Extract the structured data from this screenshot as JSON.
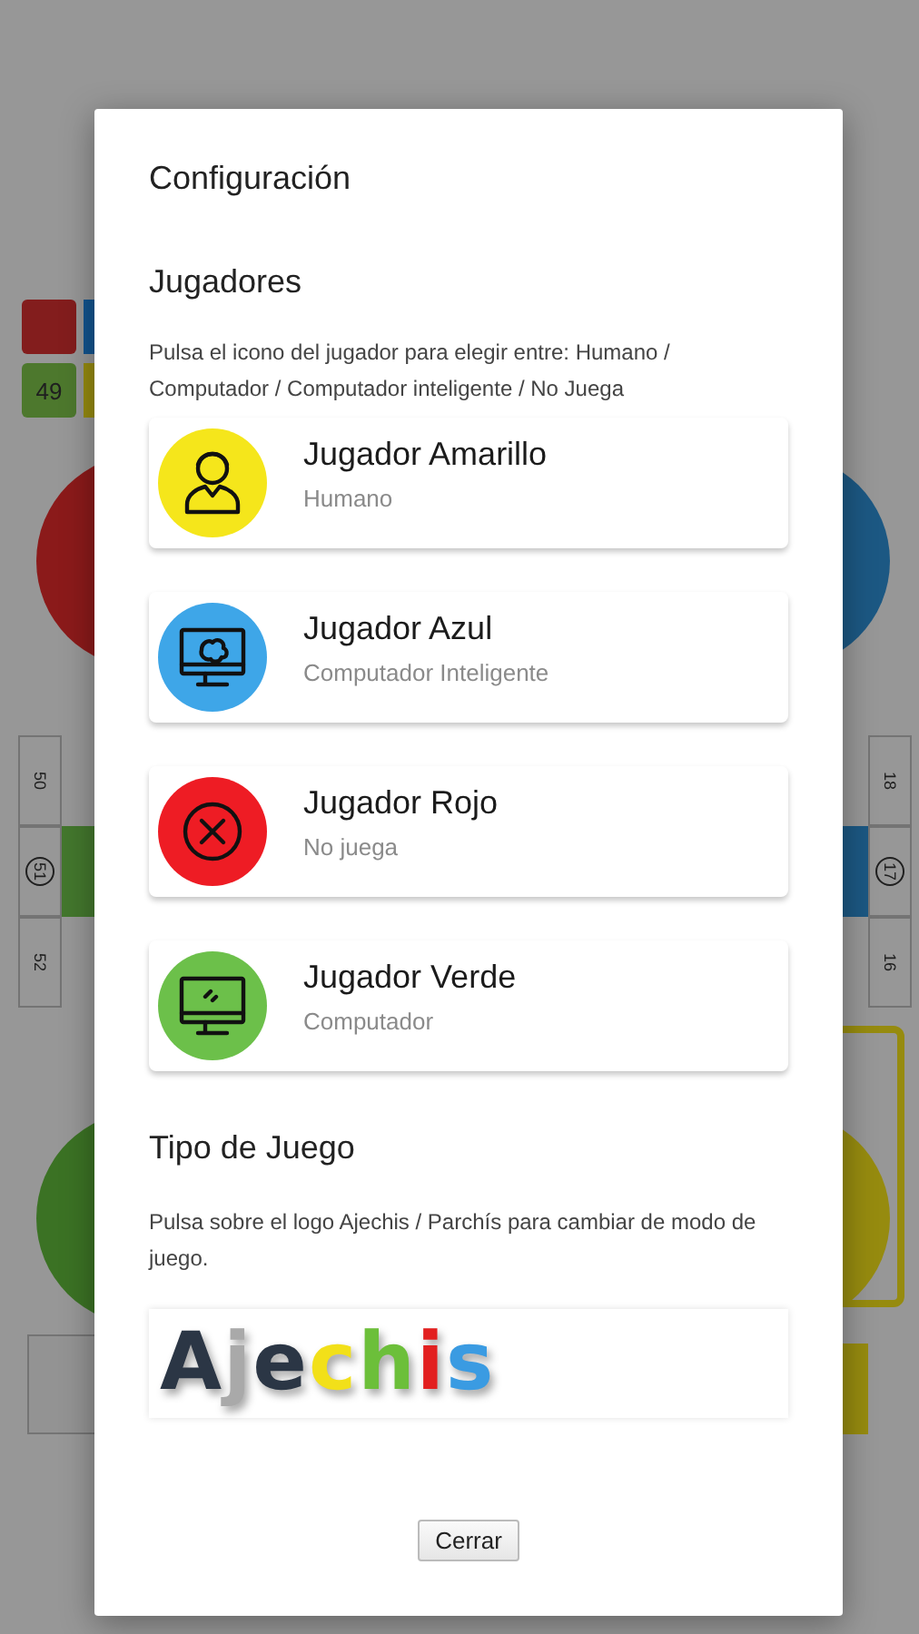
{
  "board": {
    "score": "49",
    "left_cells": [
      "50",
      "51",
      "52"
    ],
    "right_cells": [
      "18",
      "17",
      "16"
    ]
  },
  "dialog": {
    "title": "Configuración",
    "players_heading": "Jugadores",
    "players_hint": "Pulsa el icono del jugador para elegir entre: Humano / Computador / Computador inteligente / No Juega",
    "players": [
      {
        "name": "Jugador Amarillo",
        "mode": "Humano",
        "kind": "human",
        "color": "#f5e61b"
      },
      {
        "name": "Jugador Azul",
        "mode": "Computador Inteligente",
        "kind": "smart_computer",
        "color": "#3ea6e8"
      },
      {
        "name": "Jugador Rojo",
        "mode": "No juega",
        "kind": "not_playing",
        "color": "#ee1c24"
      },
      {
        "name": "Jugador Verde",
        "mode": "Computador",
        "kind": "computer",
        "color": "#6cc04a"
      }
    ],
    "game_heading": "Tipo de Juego",
    "game_hint": "Pulsa sobre el logo Ajechis / Parchís para cambiar de modo de juego.",
    "logo": [
      {
        "letter": "A",
        "color": "#2b3645"
      },
      {
        "letter": "j",
        "color": "#a9a9a9"
      },
      {
        "letter": "e",
        "color": "#2b3645"
      },
      {
        "letter": "c",
        "color": "#f2e019"
      },
      {
        "letter": "h",
        "color": "#6cbf3a"
      },
      {
        "letter": "i",
        "color": "#e21f1f"
      },
      {
        "letter": "s",
        "color": "#3a9be2"
      }
    ],
    "close_button": "Cerrar"
  }
}
